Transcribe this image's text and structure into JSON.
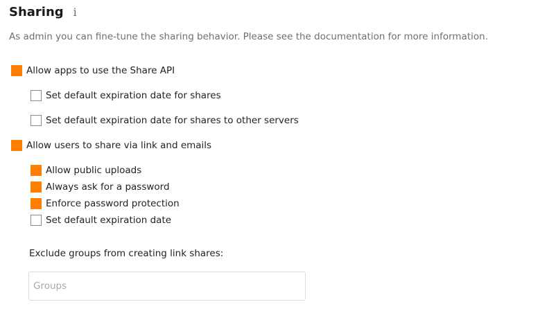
{
  "header": {
    "title": "Sharing",
    "info_icon": "i"
  },
  "description": "As admin you can fine-tune the sharing behavior. Please see the documentation for more information.",
  "options": {
    "allow_share_api": {
      "label": "Allow apps to use the Share API",
      "checked": true
    },
    "default_expiration": {
      "label": "Set default expiration date for shares",
      "checked": false
    },
    "default_expiration_remote": {
      "label": "Set default expiration date for shares to other servers",
      "checked": false
    },
    "allow_links": {
      "label": "Allow users to share via link and emails",
      "checked": true
    },
    "public_uploads": {
      "label": "Allow public uploads",
      "checked": true
    },
    "ask_password": {
      "label": "Always ask for a password",
      "checked": true
    },
    "enforce_password": {
      "label": "Enforce password protection",
      "checked": true
    },
    "link_expiration": {
      "label": "Set default expiration date",
      "checked": false
    }
  },
  "exclude_groups": {
    "label": "Exclude groups from creating link shares:",
    "placeholder": "Groups",
    "value": ""
  },
  "colors": {
    "accent": "#ff8000",
    "unchecked_border": "#8a8a8a",
    "muted_text": "#6e6e6e"
  }
}
